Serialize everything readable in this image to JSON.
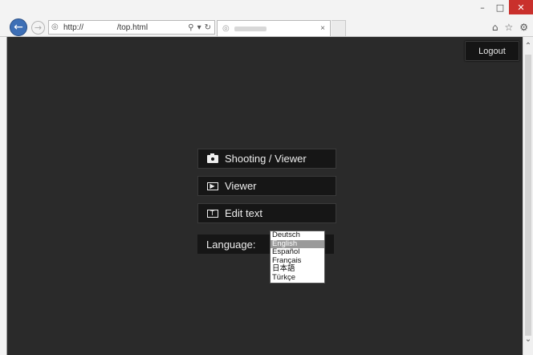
{
  "browser": {
    "address_url": "http://               /top.html",
    "address_actions": [
      "search-icon",
      "dropdown-icon",
      "refresh-icon"
    ],
    "tab_close": "×",
    "window_controls": [
      "minimize",
      "maximize",
      "close"
    ],
    "toolbar_icons": [
      "home-icon",
      "favorites-icon",
      "settings-icon"
    ]
  },
  "header": {
    "logout_label": "Logout"
  },
  "menu": {
    "shooting_viewer": "Shooting / Viewer",
    "viewer": "Viewer",
    "edit_text": "Edit text"
  },
  "language": {
    "label": "Language:",
    "options": [
      "Deutsch",
      "English",
      "Español",
      "Français",
      "日本語",
      "Türkçe"
    ],
    "selected": "English"
  },
  "colors": {
    "page_background": "#2a2a2a",
    "button_background": "#161616",
    "selected_option": "#9a9a9a",
    "close_button": "#c9302c"
  }
}
